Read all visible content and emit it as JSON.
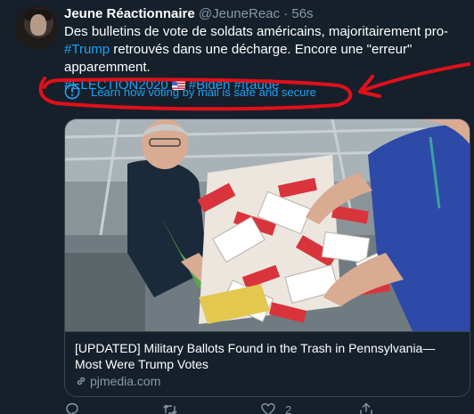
{
  "tweet": {
    "display_name": "Jeune Réactionnaire",
    "handle": "@JeuneReac",
    "separator": "·",
    "time": "56s",
    "text_part1": "Des bulletins de vote de soldats américains, majoritairement pro-",
    "hashtag_trump": "#Trump",
    "text_part2": " retrouvés dans une décharge. Encore une \"erreur\" apparemment.",
    "hashtag_election": "#ELECTION2020",
    "hashtag_biden": "#Biden",
    "hashtag_fraude": "#fraude",
    "flag_emoji": "us-flag-ballot-box-emoji"
  },
  "notice": {
    "icon": "info-icon",
    "text": "Learn how voting by mail is safe and secure",
    "annotation_color": "#e0101a"
  },
  "card": {
    "image_subject": "election workers handling piles of mail-in ballot envelopes",
    "title": "[UPDATED] Military Ballots Found in the Trash in Pennsylvania—Most Were Trump Votes",
    "domain": "pjmedia.com",
    "domain_icon": "link-icon"
  },
  "actions": {
    "reply_icon": "reply-icon",
    "retweet_icon": "retweet-icon",
    "like_icon": "heart-icon",
    "like_count": "2",
    "share_icon": "share-icon"
  },
  "colors": {
    "background": "#15202b",
    "text": "#ffffff",
    "muted": "#8899a6",
    "accent": "#1da1f2",
    "border": "#38444d"
  }
}
